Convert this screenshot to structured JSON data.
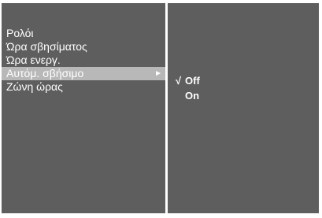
{
  "menu": {
    "items": [
      {
        "label": "Ρολόι"
      },
      {
        "label": "Ώρα σβησίματος"
      },
      {
        "label": "Ώρα ενεργ."
      },
      {
        "label": "Αυτόμ. σβήσιμο",
        "selected": true
      },
      {
        "label": "Ζώνη ώρας"
      }
    ],
    "selected_index": 3
  },
  "submenu": {
    "check_glyph": "√",
    "options": [
      {
        "label": "Off",
        "checked": true
      },
      {
        "label": "On",
        "checked": false
      }
    ]
  },
  "colors": {
    "panel_bg": "#5e5e5e",
    "highlight_bg": "#b8b8b8",
    "text": "#ffffff"
  }
}
